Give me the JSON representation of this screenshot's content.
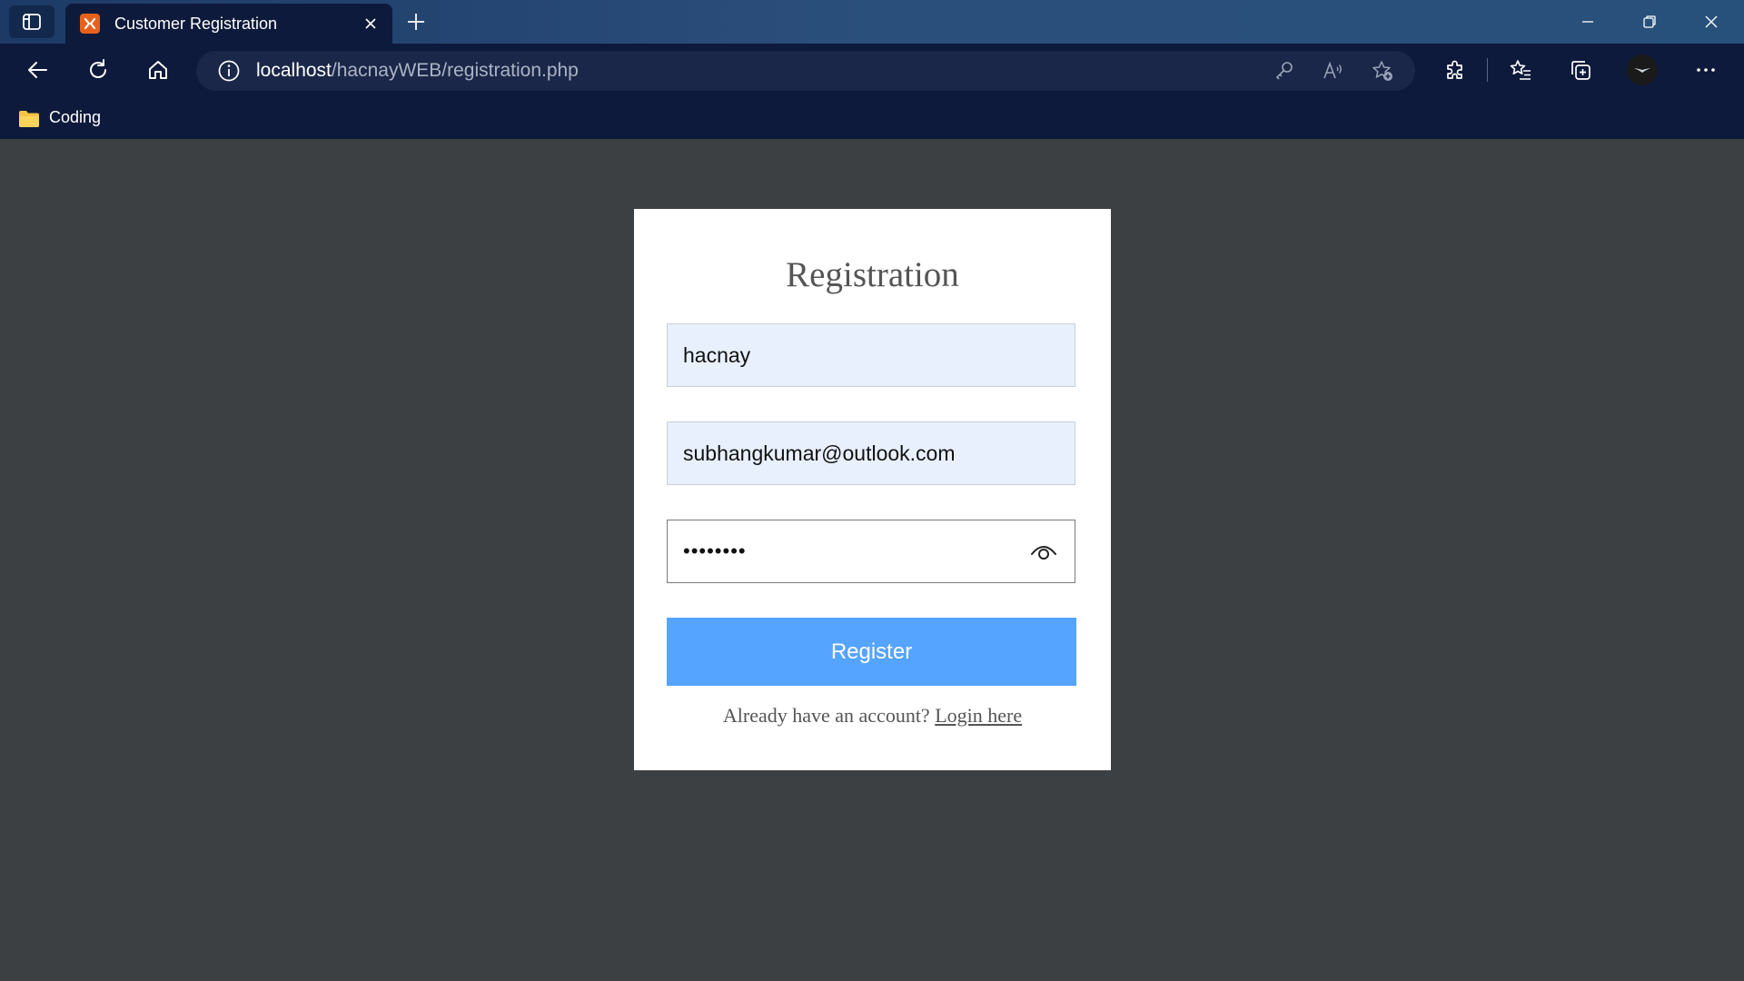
{
  "tab": {
    "title": "Customer Registration",
    "favicon": "xampp-icon"
  },
  "window_controls": [
    "minimize",
    "restore",
    "close"
  ],
  "address_bar": {
    "host": "localhost",
    "path": "/hacnayWEB/registration.php"
  },
  "bookmarks": [
    {
      "label": "Coding",
      "icon": "folder-icon"
    }
  ],
  "form": {
    "title": "Registration",
    "username_value": "hacnay",
    "email_value": "subhangkumar@outlook.com",
    "password_masked": "••••••••",
    "register_label": "Register",
    "login_prompt": "Already have an account?",
    "login_link": "Login here"
  },
  "colors": {
    "page_bg": "#3c4043",
    "card_bg": "#ffffff",
    "autofill_bg": "#e8f0fe",
    "button_bg": "#55a4ff",
    "chrome_bg": "#0e1a3b"
  }
}
